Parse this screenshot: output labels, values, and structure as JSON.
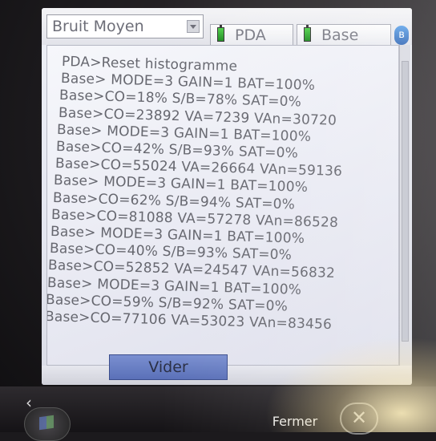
{
  "topbar": {
    "dropdown_value": "Bruit Moyen",
    "tabs": [
      {
        "label": "PDA"
      },
      {
        "label": "Base"
      }
    ],
    "bluetooth_icon": "bluetooth-icon"
  },
  "log": {
    "lines": [
      "PDA>Reset histogramme",
      "Base> MODE=3 GAIN=1 BAT=100%",
      "Base>CO=18% S/B=78% SAT=0%",
      "Base>CO=23892 VA=7239 VAn=30720",
      "Base> MODE=3 GAIN=1 BAT=100%",
      "Base>CO=42% S/B=93% SAT=0%",
      "Base>CO=55024 VA=26664 VAn=59136",
      "Base> MODE=3 GAIN=1 BAT=100%",
      "Base>CO=62% S/B=94% SAT=0%",
      "Base>CO=81088 VA=57278 VAn=86528",
      "Base> MODE=3 GAIN=1 BAT=100%",
      "Base>CO=40% S/B=93% SAT=0%",
      "Base>CO=52852 VA=24547 VAn=56832",
      "Base> MODE=3 GAIN=1 BAT=100%",
      "Base>CO=59% S/B=92% SAT=0%",
      "Base>CO=77106 VA=53023 VAn=83456"
    ]
  },
  "buttons": {
    "clear_label": "Vider",
    "close_label": "Fermer"
  },
  "colors": {
    "log_text": "#66676f",
    "button_blue": "#6a80c6",
    "battery_green": "#3cb83a"
  }
}
